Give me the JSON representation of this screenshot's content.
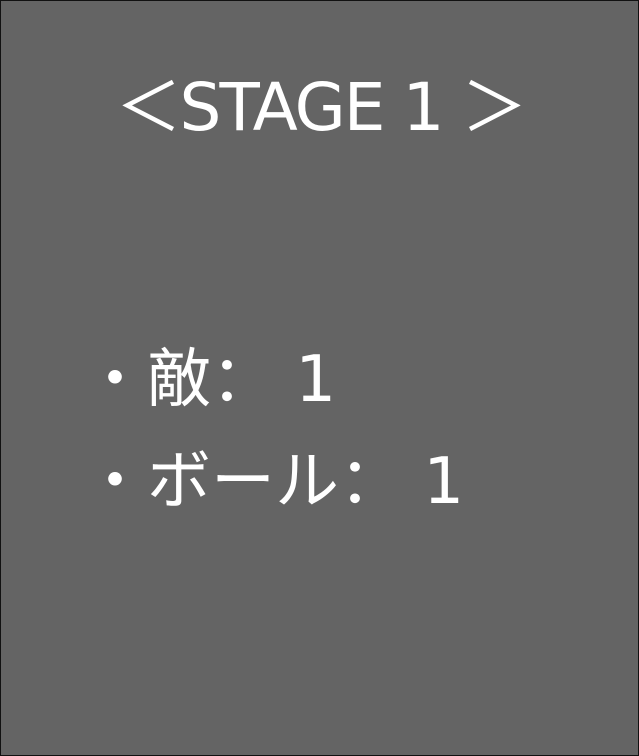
{
  "stage": {
    "title": "＜STAGE 1 ＞"
  },
  "info": {
    "items": [
      {
        "text": "・敵： 1"
      },
      {
        "text": "・ボール： 1"
      }
    ]
  },
  "colors": {
    "background": "#646464",
    "text": "#ffffff",
    "border": "#111111"
  }
}
